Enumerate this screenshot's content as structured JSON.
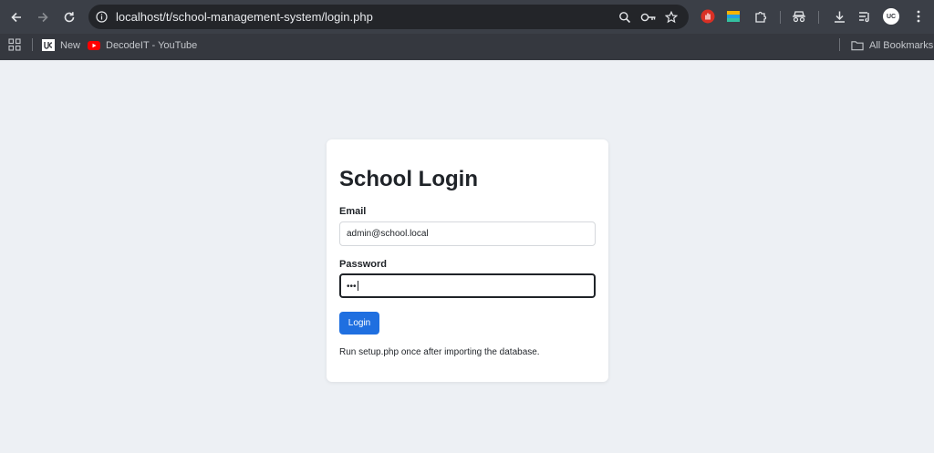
{
  "browser": {
    "url": "localhost/t/school-management-system/login.php",
    "bookmarks": [
      {
        "label": "New",
        "icon": "uc-logo-icon"
      },
      {
        "label": "DecodeIT - YouTube",
        "icon": "youtube-icon"
      }
    ],
    "all_bookmarks_label": "All Bookmarks",
    "profile_initials": "UC"
  },
  "login": {
    "title": "School Login",
    "email_label": "Email",
    "email_value": "admin@school.local",
    "password_label": "Password",
    "password_value": "•••",
    "login_button": "Login",
    "note": "Run setup.php once after importing the database."
  },
  "colors": {
    "accent": "#1f6fe0",
    "page_bg": "#edf0f4",
    "card_bg": "#ffffff"
  }
}
